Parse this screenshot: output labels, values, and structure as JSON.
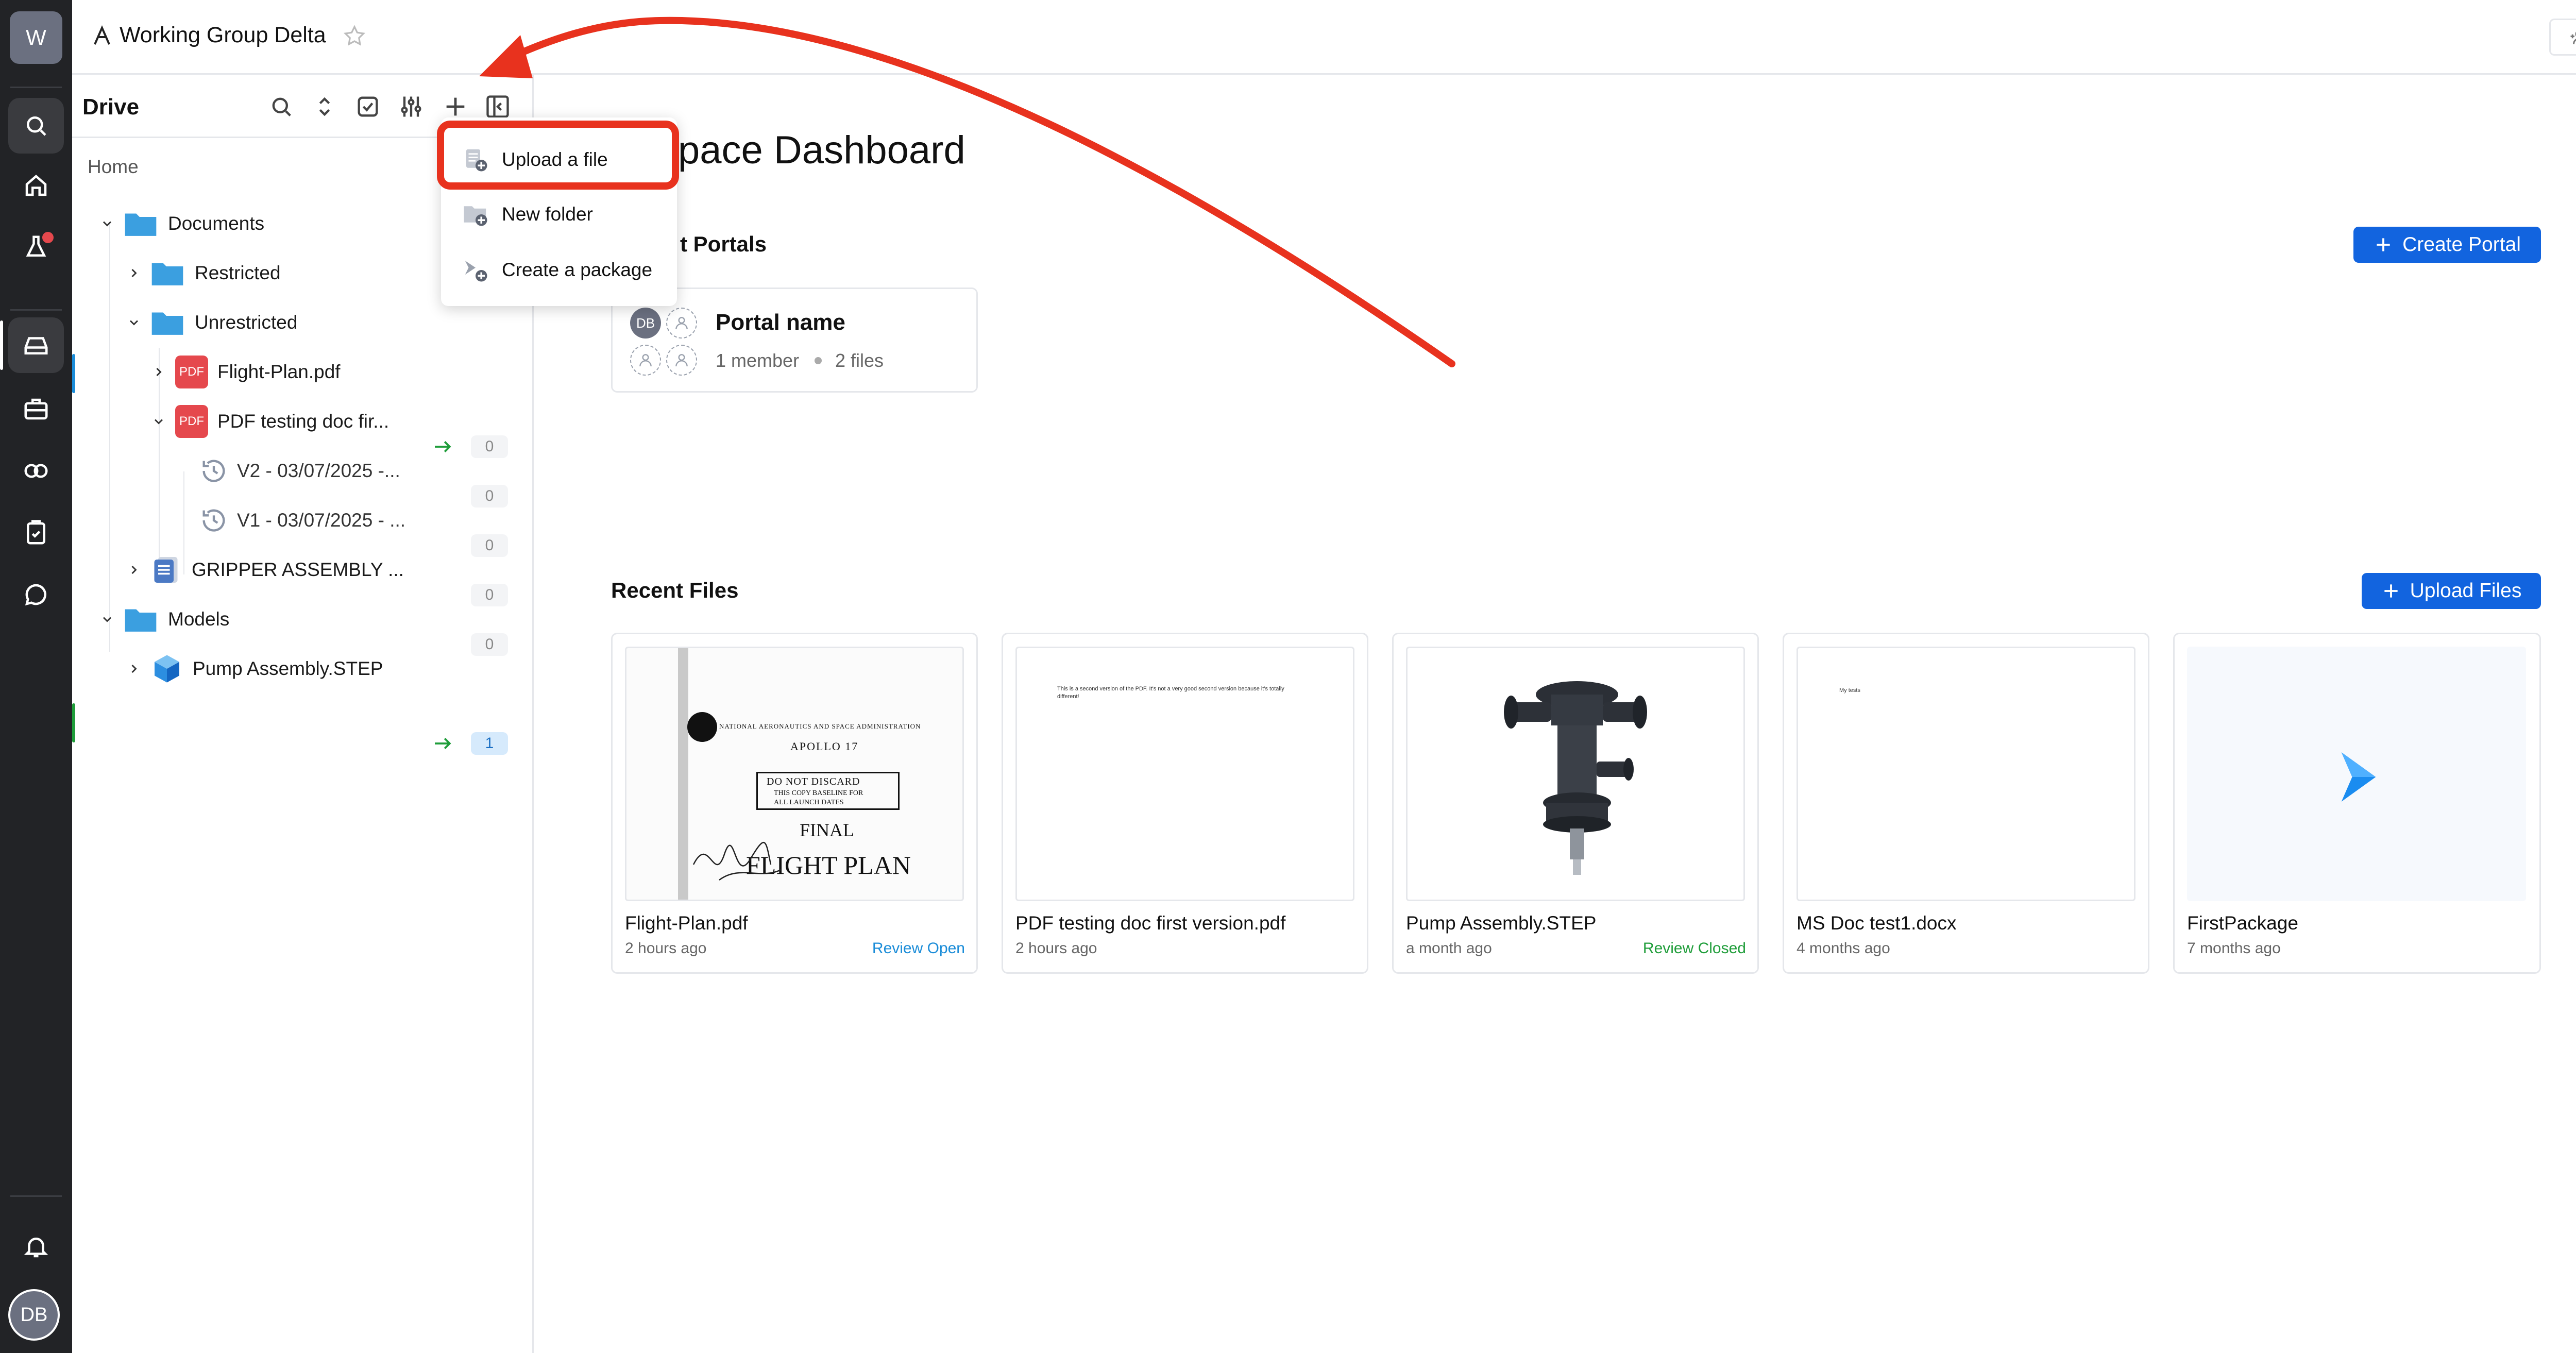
{
  "workspace": {
    "initial": "W",
    "name": "Working Group Delta",
    "members_count": "1"
  },
  "user": {
    "initials": "DB"
  },
  "sidebar": {
    "title": "Drive",
    "breadcrumb": "Home",
    "tree": [
      {
        "label": "Documents"
      },
      {
        "label": "Restricted"
      },
      {
        "label": "Unrestricted"
      },
      {
        "label": "Flight-Plan.pdf",
        "count": "0"
      },
      {
        "label": "PDF testing doc fir...",
        "count": "0"
      },
      {
        "label": "V2 - 03/07/2025 -...",
        "count": "0"
      },
      {
        "label": "V1 - 03/07/2025 - ...",
        "count": "0"
      },
      {
        "label": "GRIPPER ASSEMBLY ...",
        "count": "0"
      },
      {
        "label": "Models"
      },
      {
        "label": "Pump Assembly.STEP",
        "count": "1"
      }
    ],
    "pdf_label": "PDF"
  },
  "menu": {
    "upload": "Upload a file",
    "new_folder": "New folder",
    "create_package": "Create a package"
  },
  "main": {
    "title": "kspace Dashboard",
    "portals_heading": "t Portals",
    "create_portal": "Create Portal",
    "portal": {
      "name": "Portal name",
      "members": "1 member",
      "files": "2 files",
      "avatar": "DB"
    },
    "recent_heading": "Recent Files",
    "upload_files": "Upload Files",
    "files": [
      {
        "name": "Flight-Plan.pdf",
        "time": "2 hours ago",
        "status": "Review Open"
      },
      {
        "name": "PDF testing doc first version.pdf",
        "time": "2 hours ago",
        "status": ""
      },
      {
        "name": "Pump Assembly.STEP",
        "time": "a month ago",
        "status": "Review Closed"
      },
      {
        "name": "MS Doc test1.docx",
        "time": "4 months ago",
        "status": ""
      },
      {
        "name": "FirstPackage",
        "time": "7 months ago",
        "status": ""
      }
    ],
    "thumbs": {
      "nasa1": "NATIONAL AERONAUTICS AND SPACE ADMINISTRATION",
      "nasa2": "APOLLO 17",
      "nasa3": "DO NOT DISCARD",
      "nasa4": "THIS COPY BASELINE FOR",
      "nasa5": "ALL LAUNCH DATES",
      "nasa6": "FINAL",
      "nasa7": "FLIGHT PLAN",
      "pdf_text": "This is a second version of the PDF. It's not a very good second version because it's totally different!",
      "doc_text": "My tests"
    }
  },
  "colors": {
    "accent": "#1264df",
    "rail": "#222326",
    "annotation": "#e8321e",
    "review_open": "#1a8cd8",
    "review_closed": "#1f9d3a"
  }
}
